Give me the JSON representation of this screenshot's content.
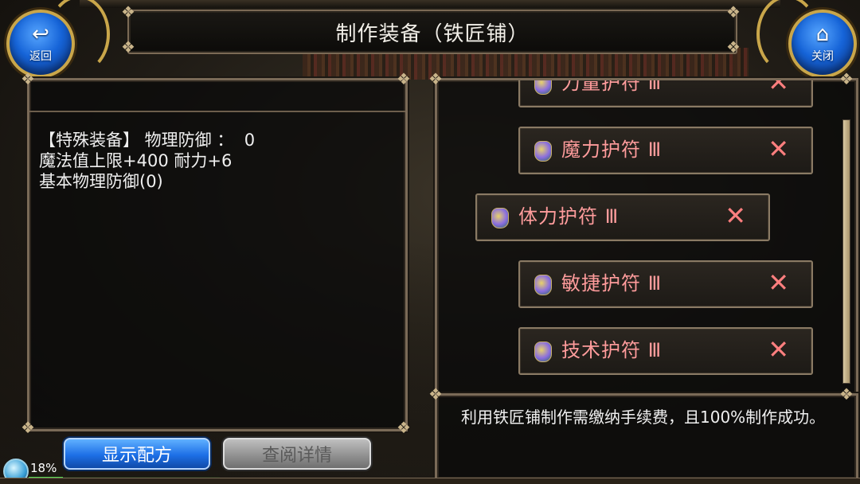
{
  "header": {
    "title": "制作装备（铁匠铺）",
    "back_label": "返回",
    "back_icon": "return-arrow-icon",
    "close_label": "关闭",
    "close_icon": "home-icon"
  },
  "left_panel": {
    "stats_text": "【特殊装备】 物理防御 ：  0\n魔法值上限+400 耐力+6\n基本物理防御(0)"
  },
  "recipe_list": [
    {
      "label": "力量护符 Ⅲ",
      "icon": "amulet-potion-icon",
      "remove_glyph": "✕"
    },
    {
      "label": "魔力护符 Ⅲ",
      "icon": "amulet-potion-icon",
      "remove_glyph": "✕"
    },
    {
      "label": "体力护符 Ⅲ",
      "icon": "amulet-potion-icon",
      "remove_glyph": "✕",
      "selected": true
    },
    {
      "label": "敏捷护符 Ⅲ",
      "icon": "amulet-potion-icon",
      "remove_glyph": "✕"
    },
    {
      "label": "技术护符 Ⅲ",
      "icon": "amulet-potion-icon",
      "remove_glyph": "✕"
    }
  ],
  "description": "利用铁匠铺制作需缴纳手续费，且100%制作成功。",
  "buttons": {
    "show_recipe": "显示配方",
    "view_details": "查阅详情"
  },
  "status": {
    "progress_text": "18%",
    "progress_fraction": 0.18
  },
  "colors": {
    "item_text": "#ff9c9c",
    "accent_blue": "#1d6fe6",
    "frame": "#7a6a57"
  }
}
